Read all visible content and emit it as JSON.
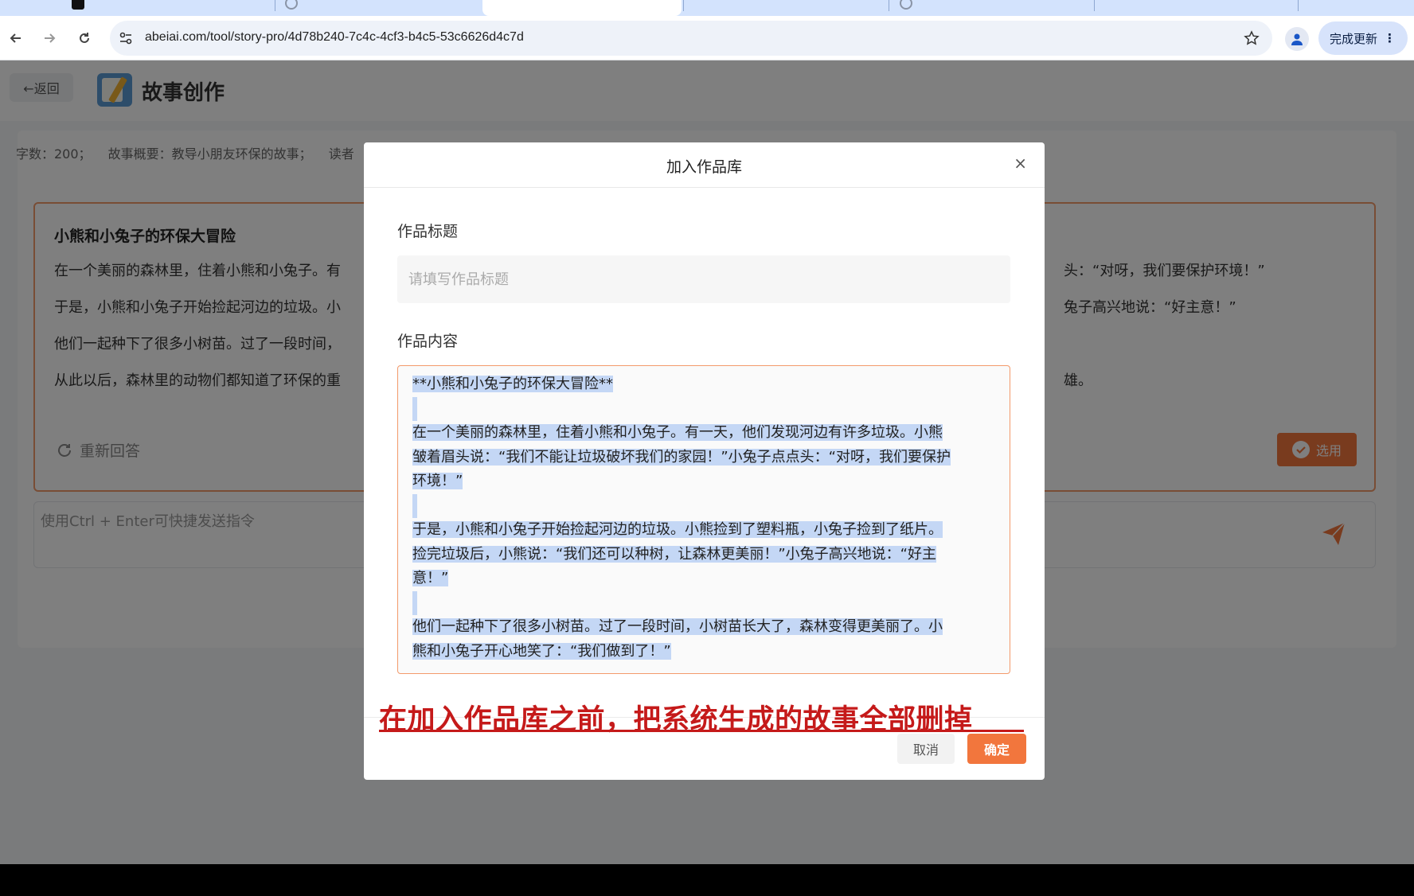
{
  "browser": {
    "url": "abeiai.com/tool/story-pro/4d78b240-7c4c-4cf3-b4c5-53c6626d4c7d",
    "update_label": "完成更新"
  },
  "app": {
    "back_label": "←返回",
    "title": "故事创作"
  },
  "meta": {
    "word_count": "字数：200；",
    "summary": "故事概要：教导小朋友环保的故事；",
    "reader": "读者"
  },
  "story": {
    "title": "小熊和小兔子的环保大冒险",
    "paragraphs_left": [
      "在一个美丽的森林里，住着小熊和小兔子。有",
      "于是，小熊和小兔子开始捡起河边的垃圾。小",
      "他们一起种下了很多小树苗。过了一段时间，",
      "从此以后，森林里的动物们都知道了环保的重"
    ],
    "paragraphs_right": [
      "头：“对呀，我们要保护环境！”",
      "兔子高兴地说：“好主意！”",
      "",
      "雄。"
    ],
    "regen_label": "重新回答",
    "use_label": "选用"
  },
  "command": {
    "placeholder": "使用Ctrl + Enter可快捷发送指令"
  },
  "modal": {
    "title": "加入作品库",
    "close_symbol": "×",
    "title_label": "作品标题",
    "title_placeholder": "请填写作品标题",
    "content_label": "作品内容",
    "content_lines": [
      "**小熊和小兔子的环保大冒险**",
      "",
      "在一个美丽的森林里，住着小熊和小兔子。有一天，他们发现河边有许多垃圾。小熊",
      "皱着眉头说：“我们不能让垃圾破坏我们的家园！”小兔子点点头：“对呀，我们要保护",
      "环境！”",
      "",
      "于是，小熊和小兔子开始捡起河边的垃圾。小熊捡到了塑料瓶，小兔子捡到了纸片。",
      "捡完垃圾后，小熊说：“我们还可以种树，让森林更美丽！”小兔子高兴地说：“好主",
      "意！”",
      "",
      "他们一起种下了很多小树苗。过了一段时间，小树苗长大了，森林变得更美丽了。小",
      "熊和小兔子开心地笑了：“我们做到了！”"
    ],
    "cancel_label": "取消",
    "ok_label": "确定"
  },
  "annotation": {
    "text": "在加入作品库之前，把系统生成的故事全部删掉"
  },
  "colors": {
    "accent": "#f2763d",
    "annotation_red": "#c51a1a",
    "selection": "#c4d7f5"
  }
}
